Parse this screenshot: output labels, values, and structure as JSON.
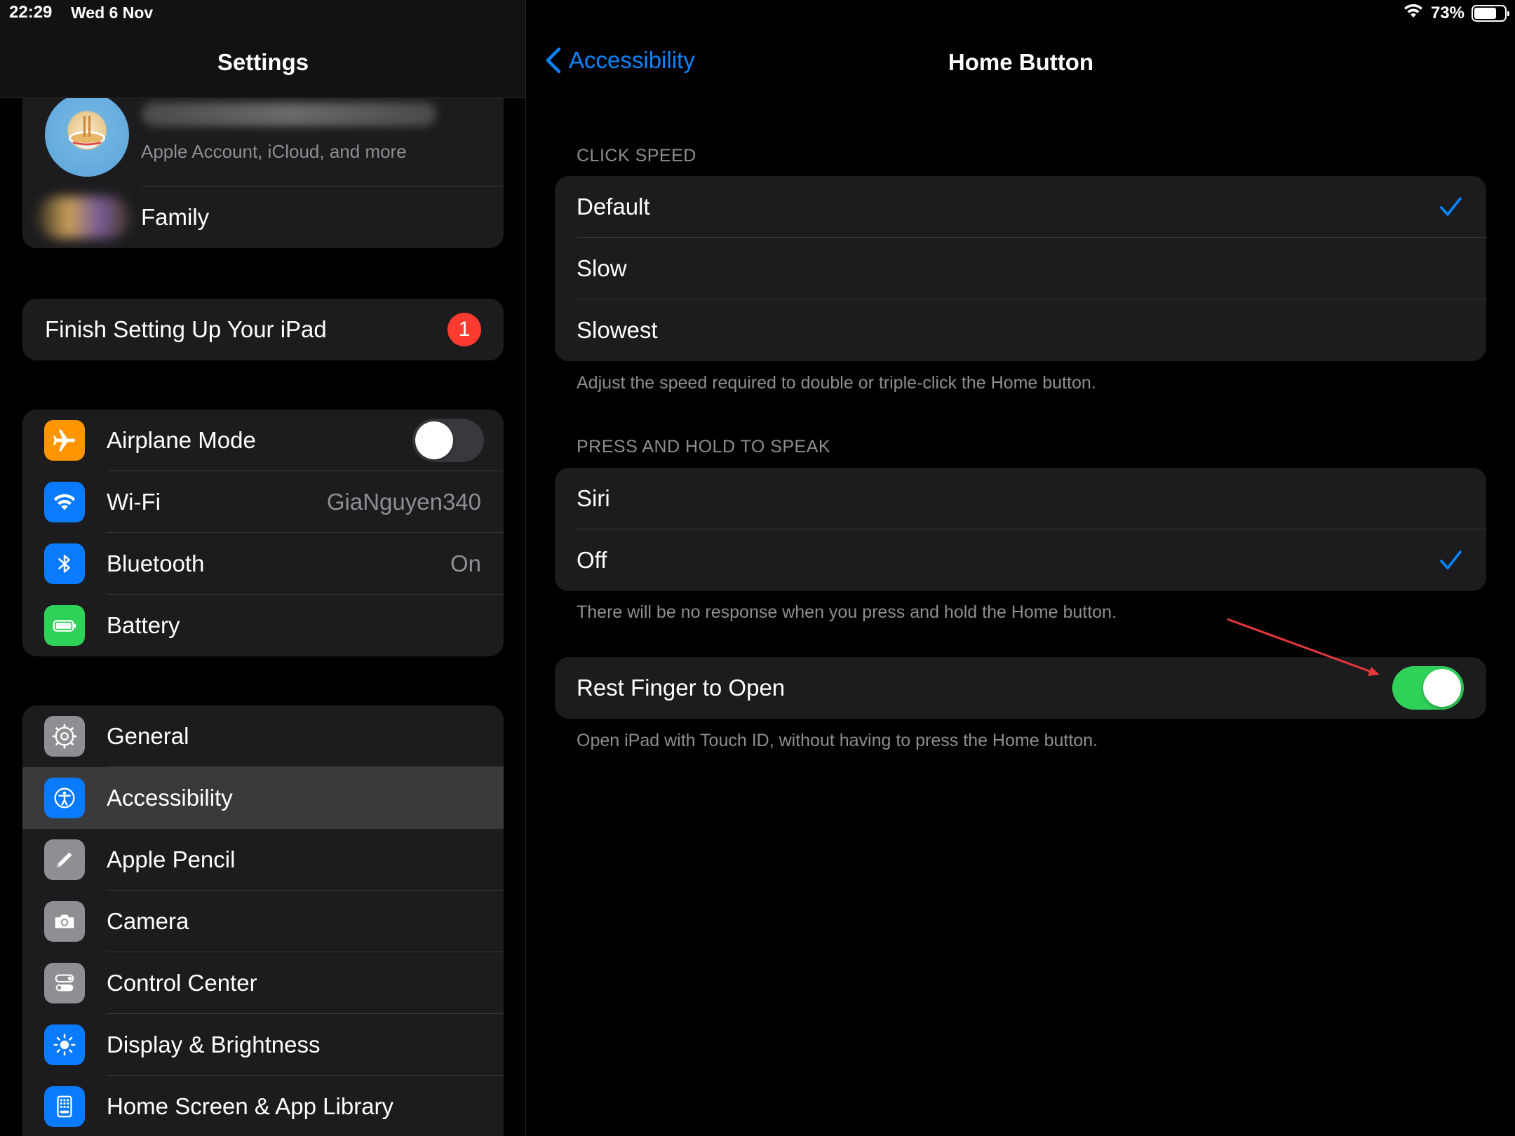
{
  "status_bar": {
    "time": "22:29",
    "date": "Wed 6 Nov",
    "battery": "73%"
  },
  "sidebar": {
    "title": "Settings",
    "account": {
      "subtitle": "Apple Account, iCloud, and more"
    },
    "family": {
      "label": "Family"
    },
    "finish_setup": {
      "label": "Finish Setting Up Your iPad",
      "badge": "1"
    },
    "connectivity": [
      {
        "label": "Airplane Mode",
        "value": ""
      },
      {
        "label": "Wi-Fi",
        "value": "GiaNguyen340"
      },
      {
        "label": "Bluetooth",
        "value": "On"
      },
      {
        "label": "Battery",
        "value": ""
      }
    ],
    "general": [
      {
        "label": "General"
      },
      {
        "label": "Accessibility"
      },
      {
        "label": "Apple Pencil"
      },
      {
        "label": "Camera"
      },
      {
        "label": "Control Center"
      },
      {
        "label": "Display & Brightness"
      },
      {
        "label": "Home Screen & App Library"
      }
    ]
  },
  "detail": {
    "back_label": "Accessibility",
    "title": "Home Button",
    "click_speed": {
      "header": "CLICK SPEED",
      "options": [
        "Default",
        "Slow",
        "Slowest"
      ],
      "selected": "Default",
      "footer": "Adjust the speed required to double or triple-click the Home button."
    },
    "press_hold": {
      "header": "PRESS AND HOLD TO SPEAK",
      "options": [
        "Siri",
        "Off"
      ],
      "selected": "Off",
      "footer": "There will be no response when you press and hold the Home button."
    },
    "rest_finger": {
      "label": "Rest Finger to Open",
      "enabled": true,
      "footer": "Open iPad with Touch ID, without having to press the Home button."
    }
  },
  "colors": {
    "accent": "#0a84ff",
    "toggle_on": "#30d158",
    "orange": "#ff9500",
    "blue": "#0a7aff",
    "green": "#30d158",
    "gray": "#8e8e93",
    "badge": "#ff3b30",
    "annotation": "#e5383b"
  }
}
